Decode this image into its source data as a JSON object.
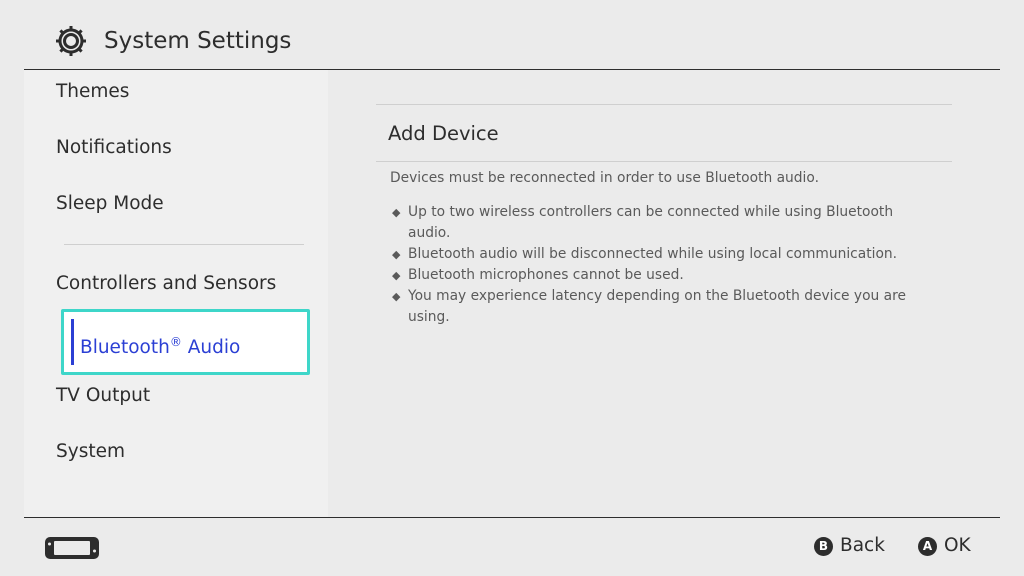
{
  "header": {
    "title": "System Settings",
    "icon": "gear-icon"
  },
  "sidebar": {
    "items": [
      {
        "label": "Themes"
      },
      {
        "label": "Notifications"
      },
      {
        "label": "Sleep Mode"
      },
      {
        "label": "Controllers and Sensors"
      },
      {
        "label": "Bluetooth® Audio",
        "label_main": "Bluetooth",
        "label_sup": "®",
        "label_rest": " Audio",
        "selected": true
      },
      {
        "label": "TV Output"
      },
      {
        "label": "System"
      }
    ]
  },
  "main": {
    "action": "Add Device",
    "info": "Devices must be reconnected in order to use Bluetooth audio.",
    "bullets": [
      "Up to two wireless controllers can be connected while using Bluetooth audio.",
      "Bluetooth audio will be disconnected while using local communication.",
      "Bluetooth microphones cannot be used.",
      "You may experience latency depending on the Bluetooth device you are using."
    ],
    "bullet_glyph": "◆"
  },
  "footer": {
    "console_icon": "handheld-console-icon",
    "hints": [
      {
        "button": "B",
        "label": "Back"
      },
      {
        "button": "A",
        "label": "OK"
      }
    ]
  },
  "colors": {
    "background": "#ebebeb",
    "sidebar": "#f0f0f0",
    "selection_border": "#3ed6c9",
    "selection_text": "#2b3fd4",
    "text": "#2d2d2d"
  }
}
